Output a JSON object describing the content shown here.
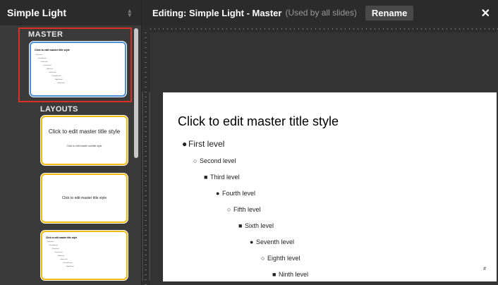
{
  "left_panel": {
    "theme_name": "Simple Light",
    "master_label": "MASTER",
    "layouts_label": "LAYOUTS",
    "master_thumb": {
      "title": "Click to edit master title style",
      "levels": [
        "• First level",
        "◦ Second level",
        "▪ Third level",
        "• Fourth level",
        "◦ Fifth level",
        "▪ Sixth level",
        "• Seventh level",
        "◦ Eighth level",
        "▪ Ninth level"
      ]
    },
    "layouts": [
      {
        "title": "Click to edit master title style",
        "subtitle": "Click to edit master subtitle style"
      },
      {
        "title": "Click to edit master title style"
      },
      {
        "title": "Click to edit master title style",
        "levels": [
          "• First level",
          "◦ Second level",
          "▪ Third level",
          "• Fourth level",
          "◦ Fifth level",
          "▪ Sixth level",
          "• Seventh level",
          "◦ Eighth level"
        ]
      }
    ]
  },
  "topbar": {
    "editing_title": "Editing: Simple Light - Master",
    "used_by": "(Used by all slides)",
    "rename_label": "Rename",
    "close_glyph": "✕"
  },
  "slide": {
    "title": "Click to edit master title style",
    "levels": [
      {
        "bullet": "●",
        "text": "First level"
      },
      {
        "bullet": "○",
        "text": "Second level"
      },
      {
        "bullet": "■",
        "text": "Third level"
      },
      {
        "bullet": "●",
        "text": "Fourth level"
      },
      {
        "bullet": "○",
        "text": "Fifth level"
      },
      {
        "bullet": "■",
        "text": "Sixth level"
      },
      {
        "bullet": "●",
        "text": "Seventh level"
      },
      {
        "bullet": "○",
        "text": "Eighth level"
      },
      {
        "bullet": "■",
        "text": "Ninth level"
      }
    ],
    "slide_number": "#"
  },
  "colors": {
    "master_highlight": "#d93025",
    "master_thumb_border": "#4a90d9",
    "layout_thumb_border": "#f2b80d"
  },
  "icons": {
    "theme_chevron": "chevron-updown-icon",
    "close": "close-icon"
  }
}
